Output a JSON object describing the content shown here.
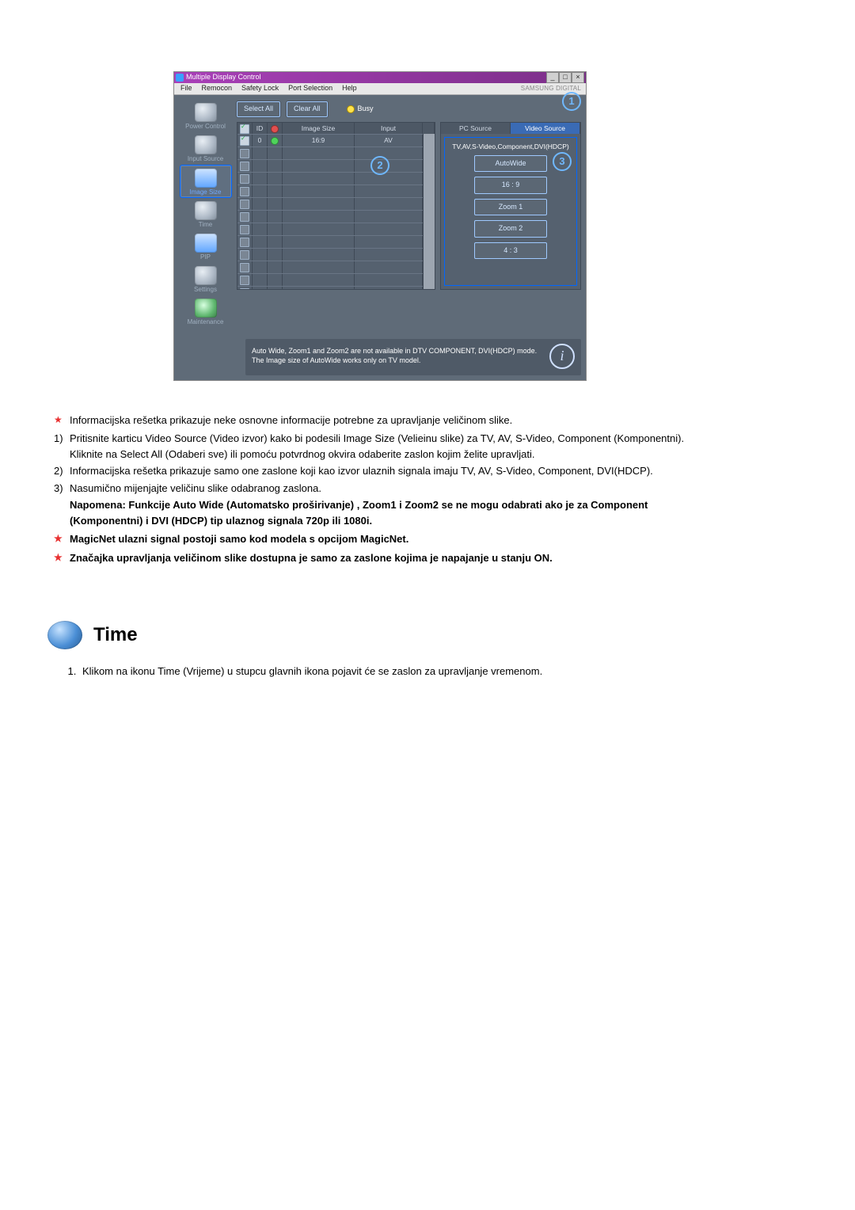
{
  "app": {
    "title": "Multiple Display Control",
    "brand": "SAMSUNG DIGITAL",
    "menu": [
      "File",
      "Remocon",
      "Safety Lock",
      "Port Selection",
      "Help"
    ],
    "window_buttons": {
      "min": "_",
      "max": "□",
      "close": "×"
    },
    "toolbar": {
      "select_all": "Select All",
      "clear_all": "Clear All",
      "busy": "Busy"
    },
    "sidebar": [
      {
        "label": "Power Control",
        "name": "power-control"
      },
      {
        "label": "Input Source",
        "name": "input-source"
      },
      {
        "label": "Image Size",
        "name": "image-size"
      },
      {
        "label": "Time",
        "name": "time"
      },
      {
        "label": "PIP",
        "name": "pip"
      },
      {
        "label": "Settings",
        "name": "settings"
      },
      {
        "label": "Maintenance",
        "name": "maintenance"
      }
    ],
    "table": {
      "headers": {
        "chk": "☑",
        "id": "ID",
        "info": "ⓘ",
        "size": "Image Size",
        "input": "Input"
      },
      "rows": [
        {
          "checked": true,
          "id": "0",
          "info": "g",
          "size": "16:9",
          "input": "AV"
        },
        {
          "checked": false,
          "id": "",
          "info": "",
          "size": "",
          "input": ""
        },
        {
          "checked": false,
          "id": "",
          "info": "",
          "size": "",
          "input": ""
        },
        {
          "checked": false,
          "id": "",
          "info": "",
          "size": "",
          "input": ""
        },
        {
          "checked": false,
          "id": "",
          "info": "",
          "size": "",
          "input": ""
        },
        {
          "checked": false,
          "id": "",
          "info": "",
          "size": "",
          "input": ""
        },
        {
          "checked": false,
          "id": "",
          "info": "",
          "size": "",
          "input": ""
        },
        {
          "checked": false,
          "id": "",
          "info": "",
          "size": "",
          "input": ""
        },
        {
          "checked": false,
          "id": "",
          "info": "",
          "size": "",
          "input": ""
        },
        {
          "checked": false,
          "id": "",
          "info": "",
          "size": "",
          "input": ""
        },
        {
          "checked": false,
          "id": "",
          "info": "",
          "size": "",
          "input": ""
        },
        {
          "checked": false,
          "id": "",
          "info": "",
          "size": "",
          "input": ""
        },
        {
          "checked": false,
          "id": "",
          "info": "",
          "size": "",
          "input": ""
        }
      ]
    },
    "right": {
      "tabs": {
        "pc": "PC Source",
        "video": "Video Source"
      },
      "caption": "TV,AV,S-Video,Component,DVI(HDCP)",
      "options": [
        "AutoWide",
        "16 : 9",
        "Zoom 1",
        "Zoom 2",
        "4 : 3"
      ]
    },
    "footnote": {
      "line1": "Auto Wide, Zoom1 and Zoom2 are not available in DTV COMPONENT, DVI(HDCP) mode.",
      "line2": "The Image size of AutoWide works only on TV model."
    },
    "callouts": {
      "c1": "1",
      "c2": "2",
      "c3": "3"
    }
  },
  "doc": {
    "star1": "Informacijska rešetka prikazuje neke osnovne informacije potrebne za upravljanje veličinom slike.",
    "items": [
      {
        "n": "1)",
        "t": "Pritisnite karticu Video Source (Video izvor) kako bi podesili Image Size (Velieinu slike) za TV, AV, S-Video, Component (Komponentni).",
        "t2": "Kliknite na Select All (Odaberi sve) ili pomoću potvrdnog okvira odaberite zaslon kojim želite upravljati."
      },
      {
        "n": "2)",
        "t": "Informacijska rešetka prikazuje samo one zaslone koji kao izvor ulaznih signala imaju TV, AV, S-Video, Component, DVI(HDCP)."
      },
      {
        "n": "3)",
        "t": "Nasumično mijenjajte veličinu slike odabranog zaslona."
      }
    ],
    "note": "Napomena: Funkcije Auto Wide (Automatsko proširivanje) , Zoom1 i Zoom2 se ne mogu odabrati ako je za Component (Komponentni) i DVI (HDCP) tip ulaznog signala 720p ili 1080i.",
    "star2": "MagicNet ulazni signal postoji samo kod modela s opcijom MagicNet.",
    "star3": "Značajka upravljanja veličinom slike dostupna je samo za zaslone kojima je napajanje u stanju ON.",
    "section": "Time",
    "section_item": "Klikom na ikonu Time (Vrijeme) u stupcu glavnih ikona pojavit će se zaslon za upravljanje vremenom."
  }
}
